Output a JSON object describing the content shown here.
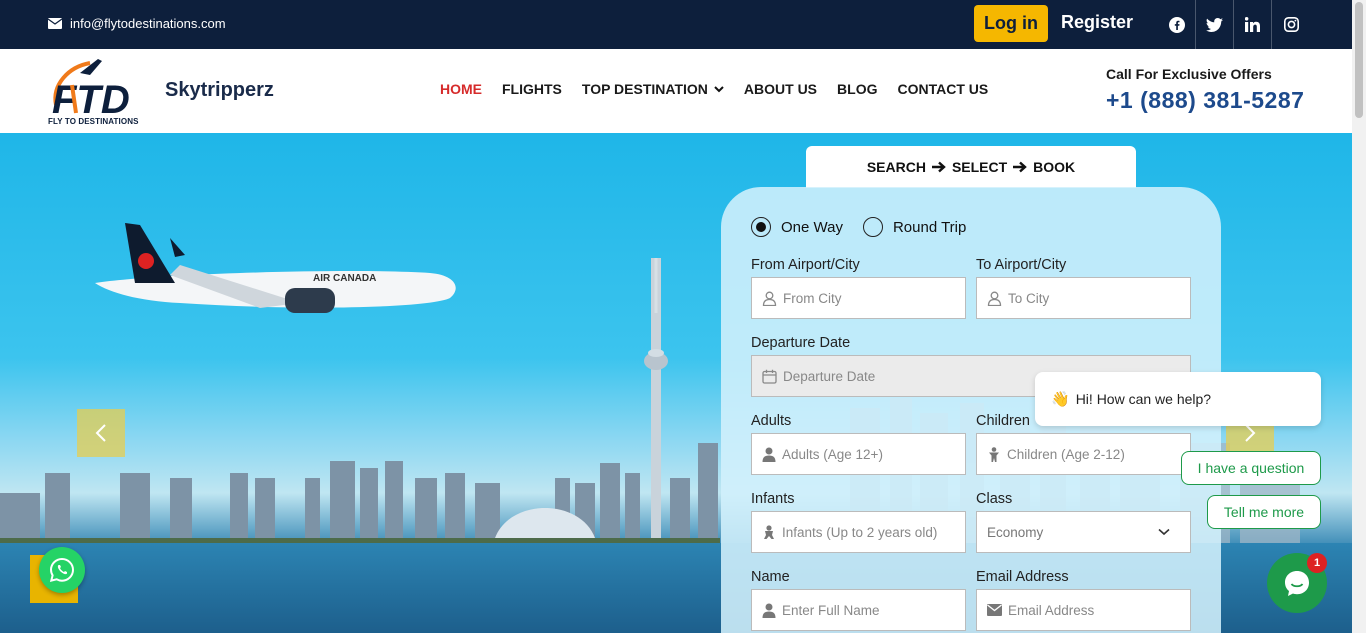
{
  "topbar": {
    "email": "info@flytodestinations.com",
    "login_label": "Log in",
    "register_label": "Register",
    "socials": [
      "facebook-icon",
      "twitter-icon",
      "linkedin-icon",
      "instagram-icon"
    ]
  },
  "header": {
    "logo_tagline": "FLY TO DESTINATIONS",
    "brand": "Skytripperz",
    "nav": [
      "HOME",
      "FLIGHTS",
      "TOP DESTINATION",
      "ABOUT US",
      "BLOG",
      "CONTACT US"
    ],
    "active_nav": "HOME",
    "offer_label": "Call For Exclusive Offers",
    "phone": "+1 (888) 381-5287"
  },
  "hero": {
    "plane_text": "AIR CANADA"
  },
  "form": {
    "steps": [
      "SEARCH",
      "SELECT",
      "BOOK"
    ],
    "trip_types": [
      "One Way",
      "Round Trip"
    ],
    "selected_trip": "One Way",
    "from_label": "From Airport/City",
    "from_placeholder": "From City",
    "to_label": "To Airport/City",
    "to_placeholder": "To City",
    "departure_label": "Departure Date",
    "departure_placeholder": "Departure Date",
    "adults_label": "Adults",
    "adults_placeholder": "Adults (Age 12+)",
    "children_label": "Children",
    "children_placeholder": "Children (Age 2-12)",
    "infants_label": "Infants",
    "infants_placeholder": "Infants (Up to 2 years old)",
    "class_label": "Class",
    "class_value": "Economy",
    "name_label": "Name",
    "name_placeholder": "Enter Full Name",
    "email_label": "Email Address",
    "email_placeholder": "Email Address"
  },
  "chat": {
    "greeting": "Hi! How can we help?",
    "option1": "I have a question",
    "option2": "Tell me more",
    "badge": "1"
  },
  "colors": {
    "topbar": "#0d1f3c",
    "accent": "#f5b700",
    "nav_active": "#d62b2b",
    "phone": "#1d4a8c",
    "chat_green": "#1e9a4a"
  }
}
